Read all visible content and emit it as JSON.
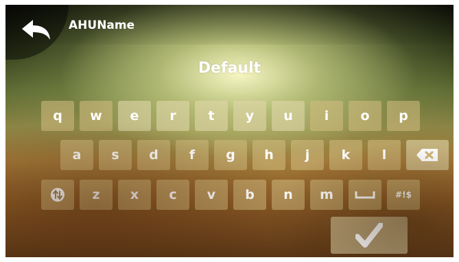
{
  "header": {
    "title": "AHUName",
    "back_icon": "back-arrow-icon"
  },
  "input": {
    "value": "Default"
  },
  "keyboard": {
    "row1": [
      "q",
      "w",
      "e",
      "r",
      "t",
      "y",
      "u",
      "i",
      "o",
      "p"
    ],
    "row2": [
      "a",
      "s",
      "d",
      "f",
      "g",
      "h",
      "j",
      "k",
      "l"
    ],
    "row3": [
      "z",
      "x",
      "c",
      "v",
      "b",
      "n",
      "m"
    ],
    "special": {
      "backspace_icon": "backspace-icon",
      "shift_icon": "shift-icon",
      "space_icon": "space-bar-icon",
      "symbols_label": "#!$",
      "enter_icon": "checkmark-icon"
    }
  }
}
